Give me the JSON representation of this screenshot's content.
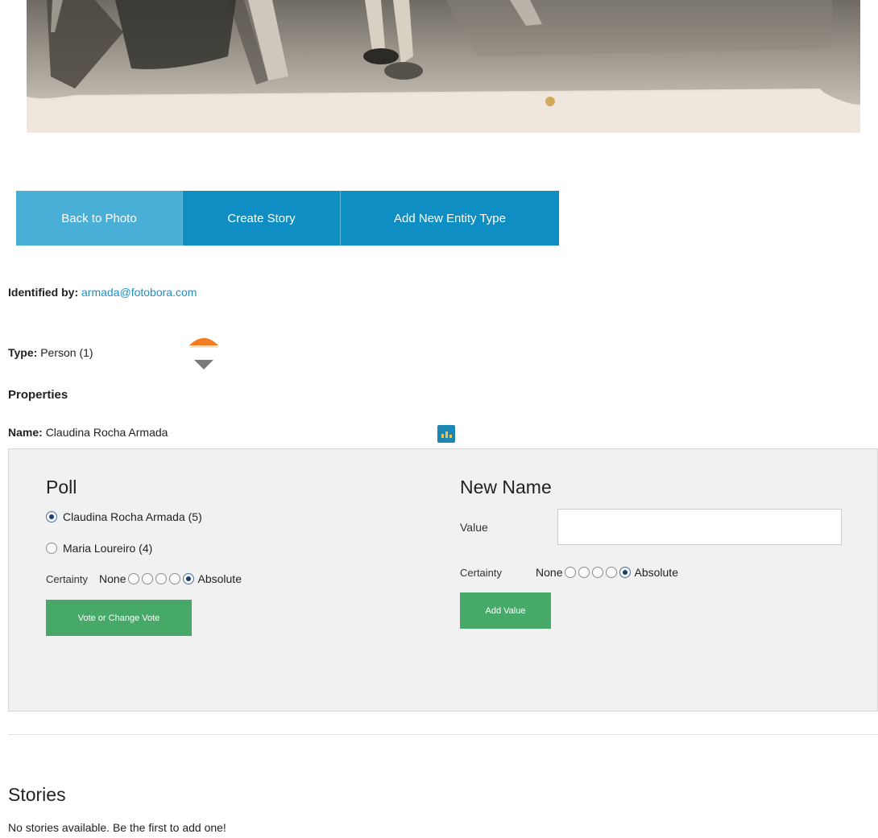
{
  "nav": {
    "back_label": "Back to Photo",
    "create_story_label": "Create Story",
    "add_entity_label": "Add New Entity Type"
  },
  "identified": {
    "label": "Identified by:",
    "email": "armada@fotobora.com"
  },
  "type": {
    "label": "Type:",
    "value": "Person (1)"
  },
  "properties_heading": "Properties",
  "name": {
    "label": "Name:",
    "value": "Claudina Rocha Armada"
  },
  "poll": {
    "title": "Poll",
    "options": [
      {
        "label": "Claudina Rocha Armada (5)",
        "checked": true
      },
      {
        "label": "Maria Loureiro (4)",
        "checked": false
      }
    ],
    "certainty_label": "Certainty",
    "certainty_min": "None",
    "certainty_max": "Absolute",
    "certainty_selected": 5,
    "vote_button": "Vote or Change Vote"
  },
  "new_name": {
    "title": "New Name",
    "value_label": "Value",
    "value": "",
    "certainty_label": "Certainty",
    "certainty_min": "None",
    "certainty_max": "Absolute",
    "certainty_selected": 5,
    "add_button": "Add Value"
  },
  "stories": {
    "heading": "Stories",
    "empty_text": "No stories available. Be the first to add one!"
  },
  "colors": {
    "nav_back": "#4aafd6",
    "nav_primary": "#0e8ec3",
    "green_button": "#47a968",
    "vote_up": "#f47c20",
    "vote_down": "#7a7a7a",
    "link": "#1e8fc6"
  },
  "icons": {
    "vote_up": "triangle-up-icon",
    "vote_down": "triangle-down-icon",
    "stats": "bar-chart-icon"
  }
}
